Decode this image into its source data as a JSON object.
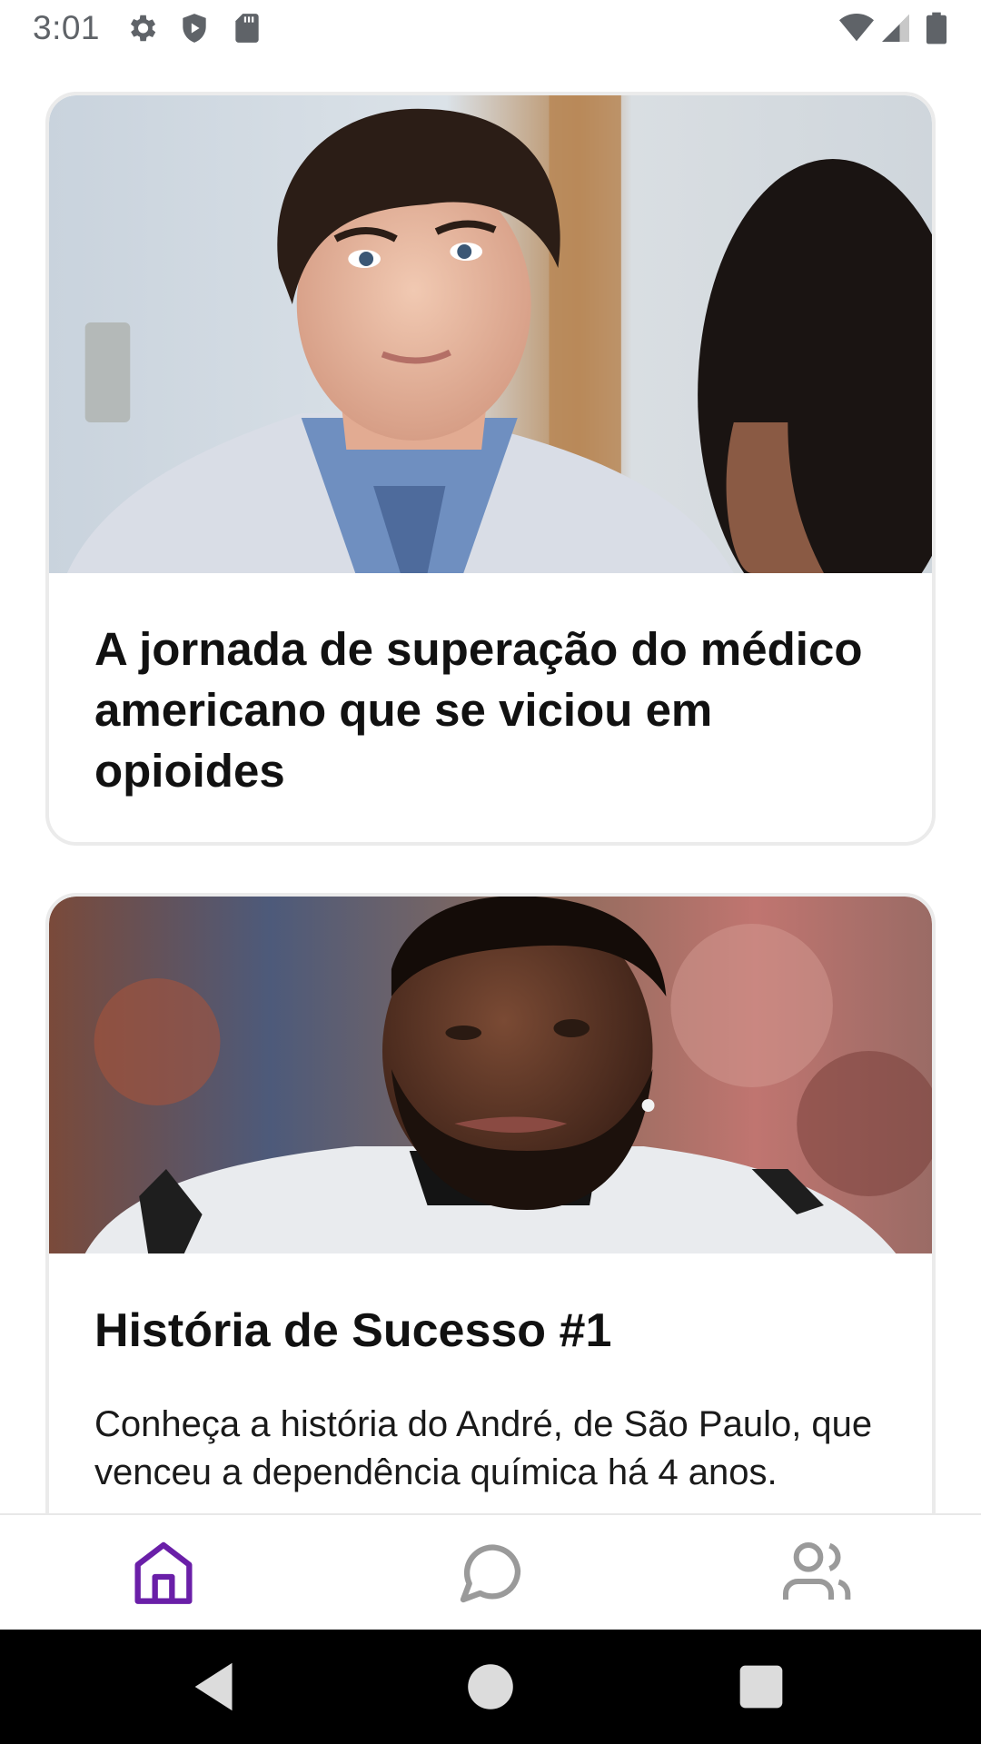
{
  "status_bar": {
    "time": "3:01",
    "icons": [
      "settings-icon",
      "shield-play-icon",
      "sd-card-icon",
      "wifi-icon",
      "cell-signal-icon",
      "battery-icon"
    ]
  },
  "feed": {
    "cards": [
      {
        "image_subject": "photo-doctor-in-white-coat",
        "title": "A jornada de superação do médico americano que se viciou em opioides"
      },
      {
        "image_subject": "photo-football-player",
        "title": "História de Sucesso #1",
        "description": "Conheça a história do André, de São Paulo, que venceu a dependência química há 4 anos."
      }
    ]
  },
  "bottom_nav": {
    "items": [
      {
        "icon": "home-icon",
        "active": true
      },
      {
        "icon": "chat-bubble-icon",
        "active": false
      },
      {
        "icon": "users-icon",
        "active": false
      }
    ],
    "active_color": "#6a1fa8",
    "inactive_color": "#9a9a9a"
  },
  "system_nav": {
    "buttons": [
      "back-icon",
      "home-circle-icon",
      "recents-square-icon"
    ]
  }
}
